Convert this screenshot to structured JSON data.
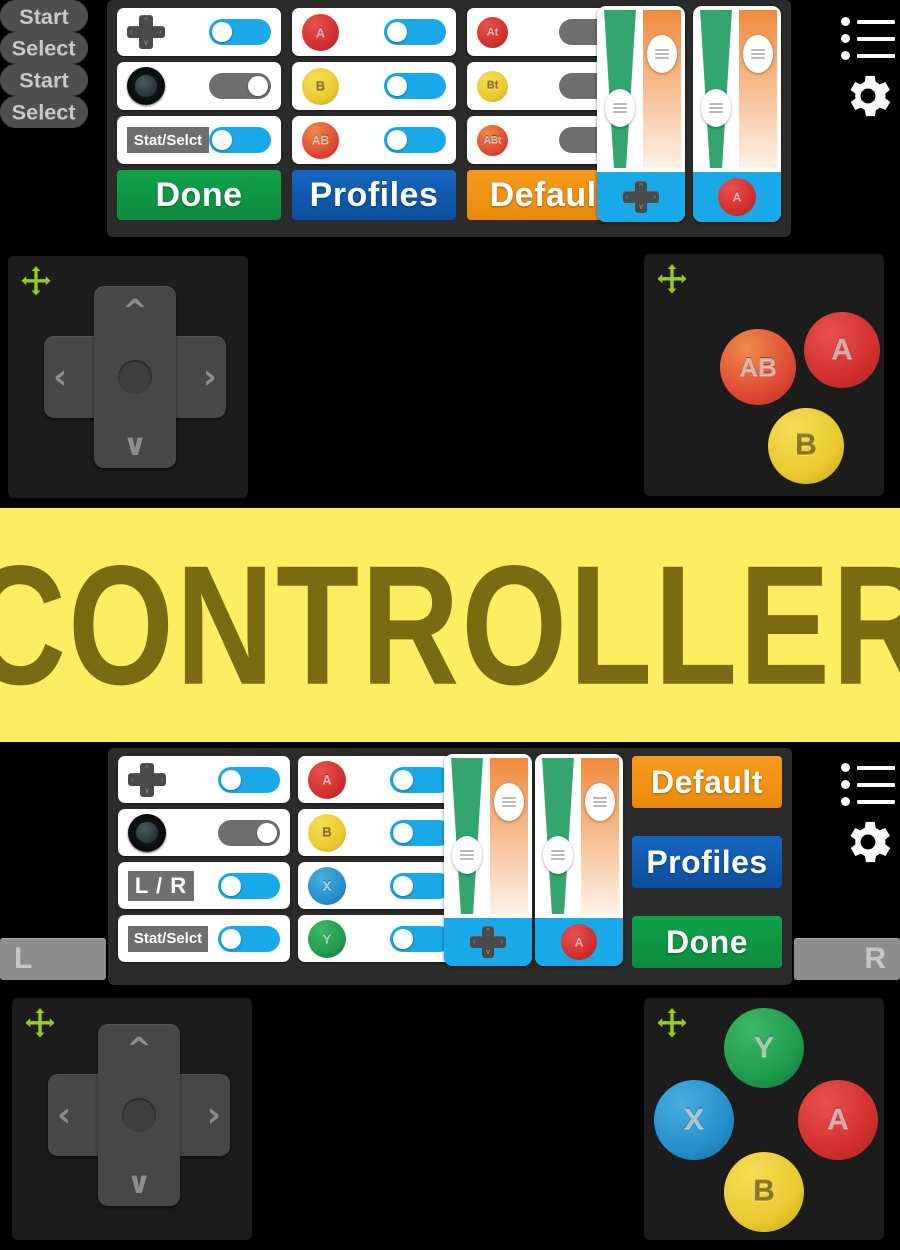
{
  "app": {
    "banner_text": "CONTROLLER",
    "banner_bg": "#fcee61",
    "banner_fg": "#7a6b13",
    "background": "#000000",
    "accent_on": "#19a9e8",
    "accent_off": "#6e6e6e"
  },
  "top_section": {
    "side_buttons": [
      {
        "label": "Start",
        "name": "start-button"
      },
      {
        "label": "Select",
        "name": "select-button"
      }
    ],
    "toggle_grid": {
      "columns": 3,
      "rows": 3,
      "items": [
        {
          "icon": "dpad-icon",
          "label": "",
          "state": "on"
        },
        {
          "icon": "a-button-icon",
          "label": "A",
          "state": "on"
        },
        {
          "icon": "at-button-icon",
          "label": "At",
          "state": "off"
        },
        {
          "icon": "joystick-icon",
          "label": "",
          "state": "off"
        },
        {
          "icon": "b-button-icon",
          "label": "B",
          "state": "on"
        },
        {
          "icon": "bt-button-icon",
          "label": "Bt",
          "state": "off"
        },
        {
          "icon": "tag-icon",
          "label": "Stat/Selct",
          "state": "on"
        },
        {
          "icon": "ab-button-icon",
          "label": "AB",
          "state": "on"
        },
        {
          "icon": "abt-button-icon",
          "label": "ABt",
          "state": "off"
        }
      ]
    },
    "action_buttons": [
      {
        "label": "Done",
        "color": "green"
      },
      {
        "label": "Profiles",
        "color": "blue"
      },
      {
        "label": "Default",
        "color": "orange"
      }
    ],
    "sliders": [
      {
        "name": "dpad-size-opacity-slider",
        "foot_icon": "dpad-icon",
        "foot_label": "",
        "size_pct": 62,
        "opacity_pct": 28
      },
      {
        "name": "a-size-opacity-slider",
        "foot_icon": "a-button-icon",
        "foot_label": "A",
        "size_pct": 62,
        "opacity_pct": 28
      }
    ],
    "menu_icons": [
      {
        "name": "list-icon",
        "label": "list"
      },
      {
        "name": "gear-icon",
        "label": "settings"
      }
    ],
    "overlay_dpad": {
      "name": "dpad-overlay",
      "move_handle": "move-icon"
    },
    "overlay_buttons": {
      "name": "buttons-overlay",
      "move_handle": "move-icon",
      "buttons": [
        {
          "label": "AB",
          "color": "ab"
        },
        {
          "label": "A",
          "color": "a"
        },
        {
          "label": "B",
          "color": "b"
        }
      ]
    }
  },
  "bottom_section": {
    "side_buttons": [
      {
        "label": "Start",
        "name": "start-button"
      },
      {
        "label": "Select",
        "name": "select-button"
      }
    ],
    "shoulders": [
      {
        "label": "L",
        "name": "shoulder-left-button"
      },
      {
        "label": "R",
        "name": "shoulder-right-button"
      }
    ],
    "toggle_grid": {
      "columns": 2,
      "rows": 4,
      "items": [
        {
          "icon": "dpad-icon",
          "label": "",
          "state": "on"
        },
        {
          "icon": "a-button-icon",
          "label": "A",
          "state": "on"
        },
        {
          "icon": "joystick-icon",
          "label": "",
          "state": "off"
        },
        {
          "icon": "b-button-icon",
          "label": "B",
          "state": "on"
        },
        {
          "icon": "tag-icon",
          "label": "L / R",
          "state": "on"
        },
        {
          "icon": "x-button-icon",
          "label": "X",
          "state": "on"
        },
        {
          "icon": "tag-icon",
          "label": "Stat/Selct",
          "state": "on"
        },
        {
          "icon": "y-button-icon",
          "label": "Y",
          "state": "on"
        }
      ]
    },
    "action_buttons": [
      {
        "label": "Default",
        "color": "orange"
      },
      {
        "label": "Profiles",
        "color": "blue"
      },
      {
        "label": "Done",
        "color": "green"
      }
    ],
    "sliders": [
      {
        "name": "dpad-size-opacity-slider",
        "foot_icon": "dpad-icon",
        "foot_label": "",
        "size_pct": 62,
        "opacity_pct": 28
      },
      {
        "name": "a-size-opacity-slider",
        "foot_icon": "a-button-icon",
        "foot_label": "A",
        "size_pct": 62,
        "opacity_pct": 28
      }
    ],
    "menu_icons": [
      {
        "name": "list-icon",
        "label": "list"
      },
      {
        "name": "gear-icon",
        "label": "settings"
      }
    ],
    "overlay_dpad": {
      "name": "dpad-overlay",
      "move_handle": "move-icon"
    },
    "overlay_buttons": {
      "name": "buttons-overlay",
      "move_handle": "move-icon",
      "buttons": [
        {
          "label": "Y",
          "color": "y"
        },
        {
          "label": "X",
          "color": "x"
        },
        {
          "label": "A",
          "color": "a"
        },
        {
          "label": "B",
          "color": "b"
        }
      ]
    }
  }
}
